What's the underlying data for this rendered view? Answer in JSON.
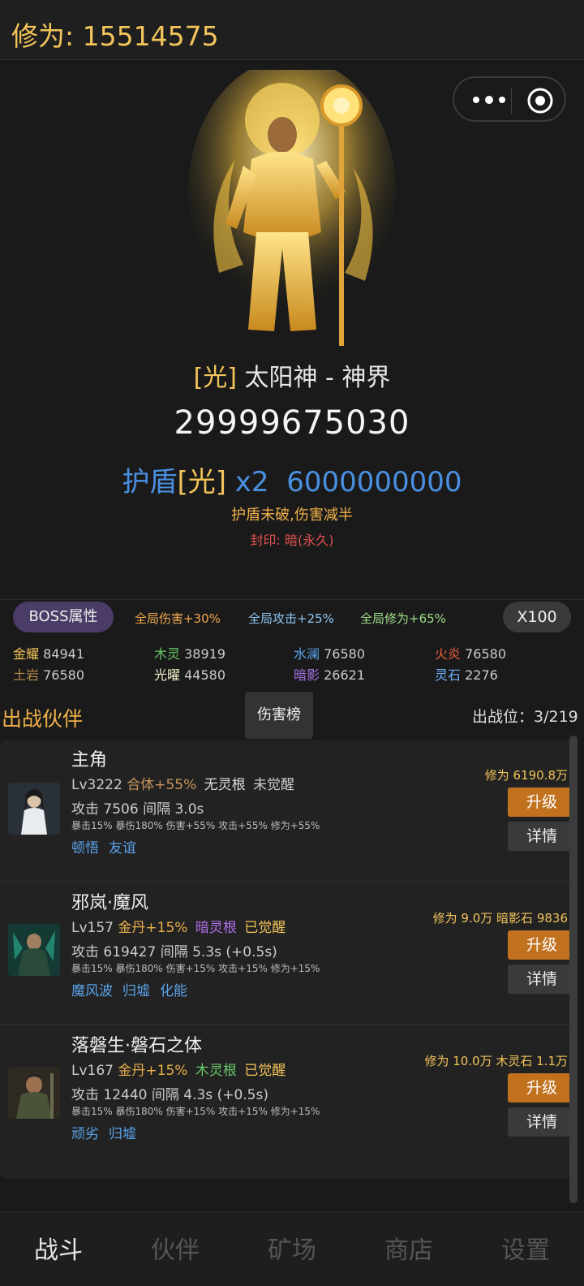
{
  "header": {
    "xiuwei": "修为: 15514575"
  },
  "boss": {
    "attr": "[光]",
    "name": " 太阳神 - 神界",
    "hp": "29999675030",
    "shield_label": "护盾",
    "shield_attr": "[光]",
    "shield_mult": " x2  ",
    "shield_value": "6000000000",
    "shield_note": "护盾未破,伤害减半",
    "seal": "封印: 暗(永久)"
  },
  "buffs": {
    "boss_attr_button": "BOSS属性",
    "items": [
      {
        "text": "全局伤害+30%",
        "color": "#f0a850"
      },
      {
        "text": "全局攻击+25%",
        "color": "#8ec5f0"
      },
      {
        "text": "全局修为+65%",
        "color": "#9edc8a"
      }
    ],
    "multiplier_button": "X100"
  },
  "stones": [
    {
      "name": "金耀",
      "value": "84941",
      "color": "#f2c45a"
    },
    {
      "name": "木灵",
      "value": "38919",
      "color": "#6bc96b"
    },
    {
      "name": "水澜",
      "value": "76580",
      "color": "#5aa2e8"
    },
    {
      "name": "火炎",
      "value": "76580",
      "color": "#e8603c"
    },
    {
      "name": "土岩",
      "value": "76580",
      "color": "#b58a4a"
    },
    {
      "name": "光曜",
      "value": "44580",
      "color": "#f5f0c8"
    },
    {
      "name": "暗影",
      "value": "26621",
      "color": "#a070e0"
    },
    {
      "name": "灵石",
      "value": "2276",
      "color": "#6fb2ff"
    }
  ],
  "partners": {
    "title": "出战伙伴",
    "damage_tab": "伤害榜",
    "slots": "出战位：3/219",
    "upgrade_label": "升级",
    "detail_label": "详情",
    "list": [
      {
        "name": "主角",
        "level": "Lv3222",
        "realm": "合体+55%",
        "realm_color": "#c8965a",
        "root": "无灵根",
        "root_color": "#dddddd",
        "awake": "未觉醒",
        "awake_color": "#cccccc",
        "attack": "攻击 7506  间隔 3.0s",
        "stats": "暴击15% 暴伤180% 伤害+55% 攻击+55% 修为+55%",
        "skills": [
          "顿悟",
          "友谊"
        ],
        "cost": "修为 6190.8万"
      },
      {
        "name": "邪岚·魔风",
        "level": "Lv157",
        "realm": "金丹+15%",
        "realm_color": "#e8b04a",
        "root": "暗灵根",
        "root_color": "#b070e8",
        "awake": "已觉醒",
        "awake_color": "#f2c45a",
        "attack": "攻击 619427  间隔 5.3s (+0.5s)",
        "stats": "暴击15% 暴伤180% 伤害+15% 攻击+15% 修为+15%",
        "skills": [
          "魔风波",
          "归墟",
          "化能"
        ],
        "cost": "修为 9.0万  暗影石 9836"
      },
      {
        "name": "落磐生·磐石之体",
        "level": "Lv167",
        "realm": "金丹+15%",
        "realm_color": "#e8b04a",
        "root": "木灵根",
        "root_color": "#6bc96b",
        "awake": "已觉醒",
        "awake_color": "#f2c45a",
        "attack": "攻击 12440  间隔 4.3s (+0.5s)",
        "stats": "暴击15% 暴伤180% 伤害+15% 攻击+15% 修为+15%",
        "skills": [
          "顽劣",
          "归墟"
        ],
        "cost": "修为 10.0万  木灵石 1.1万"
      }
    ]
  },
  "tabs": [
    {
      "label": "战斗",
      "active": true
    },
    {
      "label": "伙伴",
      "active": false
    },
    {
      "label": "矿场",
      "active": false
    },
    {
      "label": "商店",
      "active": false
    },
    {
      "label": "设置",
      "active": false
    }
  ]
}
